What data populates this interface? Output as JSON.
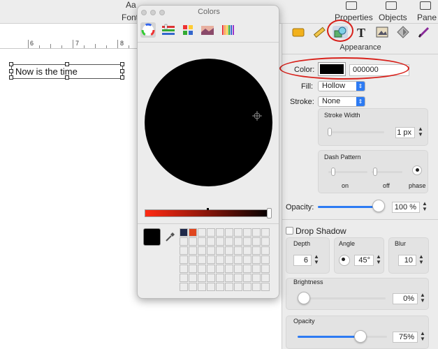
{
  "toolbar": {
    "fonts_label": "Font",
    "fonts_glyph": "Aa",
    "properties_label": "Properties",
    "objects_label": "Objects",
    "pane_label": "Pane"
  },
  "ruler": {
    "marks": [
      "6",
      "7",
      "8"
    ]
  },
  "canvas": {
    "text_box": "Now is the time"
  },
  "colors_panel": {
    "title": "Colors",
    "pickers": [
      "color-wheel",
      "color-sliders",
      "color-palettes",
      "image-palettes",
      "pencils"
    ],
    "current_color": "#000000",
    "swatches": [
      "#1f2a4a",
      "#e0461e"
    ]
  },
  "inspector": {
    "section_title": "Appearance",
    "color_label": "Color:",
    "color_hex": "000000",
    "fill_label": "Fill:",
    "fill_value": "Hollow",
    "stroke_label": "Stroke:",
    "stroke_value": "None",
    "stroke_width_label": "Stroke Width",
    "stroke_width_value": "1 px",
    "dash_pattern_label": "Dash Pattern",
    "dash_on": "on",
    "dash_off": "off",
    "dash_phase": "phase",
    "opacity_label": "Opacity:",
    "opacity_value": "100 %",
    "drop_shadow_label": "Drop Shadow",
    "depth_label": "Depth",
    "depth_value": "6",
    "angle_label": "Angle",
    "angle_value": "45°",
    "blur_label": "Blur",
    "blur_value": "10",
    "brightness_label": "Brightness",
    "brightness_value": "0%",
    "shadow_opacity_label": "Opacity",
    "shadow_opacity_value": "75%"
  },
  "annotation_color": "#d8201a",
  "accent_color": "#2d7bf3"
}
